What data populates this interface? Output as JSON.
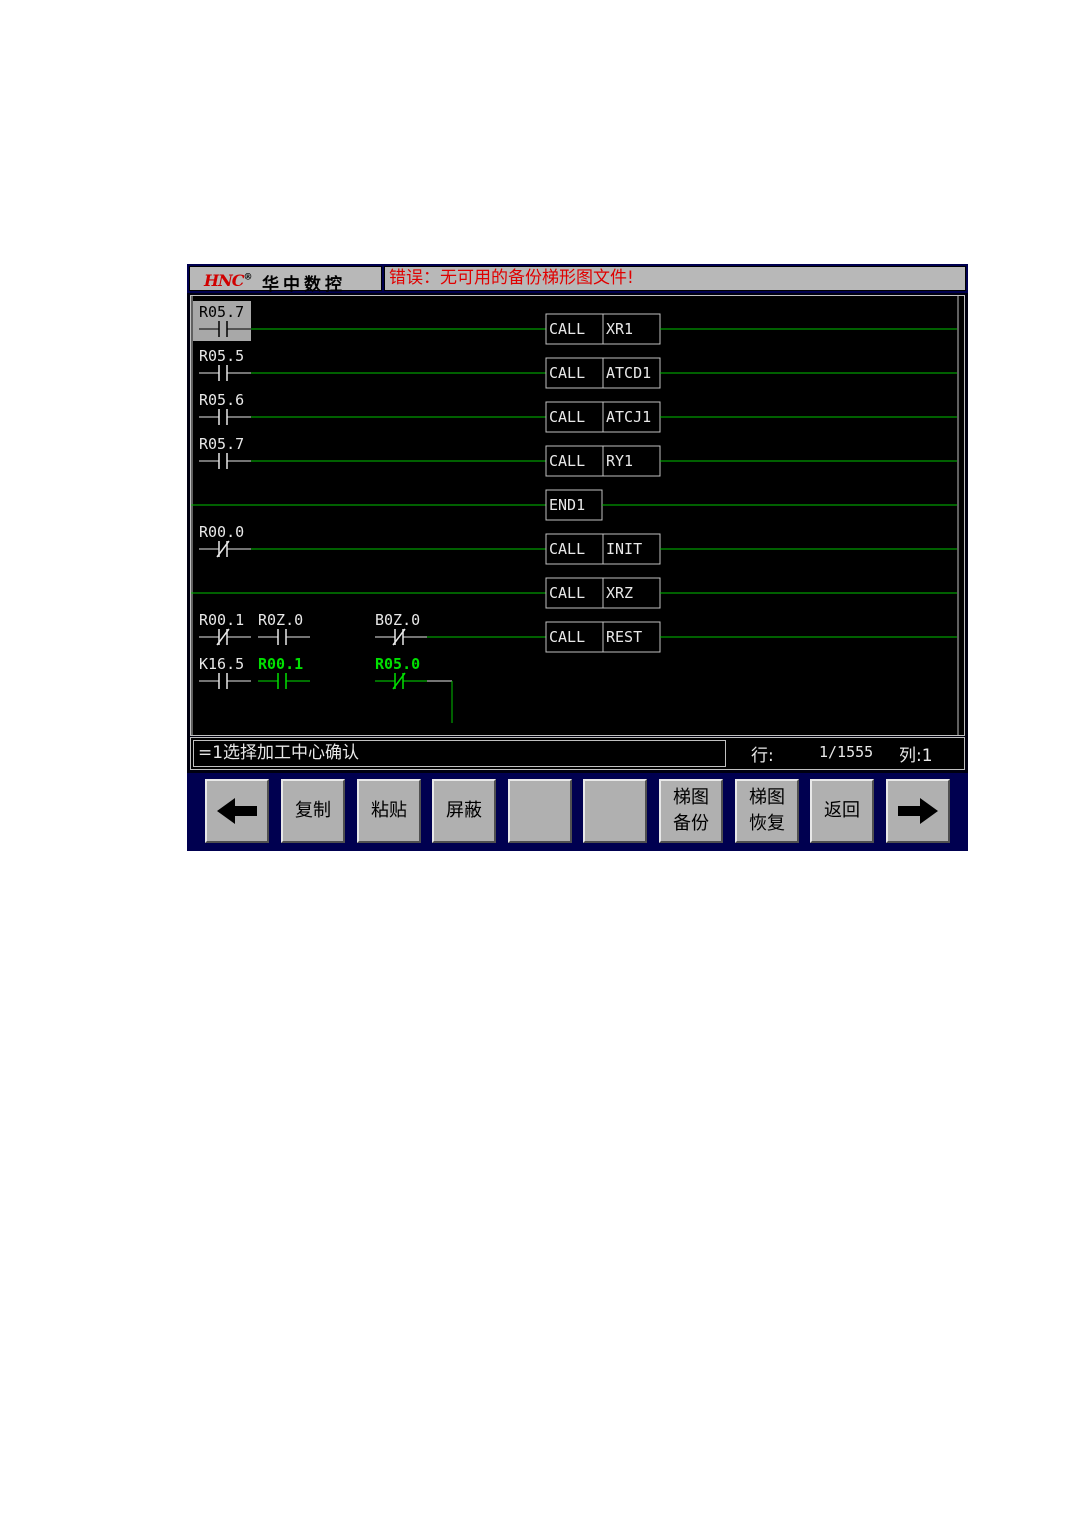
{
  "header": {
    "logo_mark": "HNC",
    "logo_text": "华中数控",
    "error_message": "错误：无可用的备份梯形图文件!"
  },
  "ladder": {
    "rungs": [
      {
        "contacts": [
          {
            "label": "R05.7",
            "type": "NO",
            "selected": true
          }
        ],
        "coil": {
          "op": "CALL",
          "arg": "XR1"
        }
      },
      {
        "contacts": [
          {
            "label": "R05.5",
            "type": "NO"
          }
        ],
        "coil": {
          "op": "CALL",
          "arg": "ATCD1"
        }
      },
      {
        "contacts": [
          {
            "label": "R05.6",
            "type": "NO"
          }
        ],
        "coil": {
          "op": "CALL",
          "arg": "ATCJ1"
        }
      },
      {
        "contacts": [
          {
            "label": "R05.7",
            "type": "NO"
          }
        ],
        "coil": {
          "op": "CALL",
          "arg": "RY1"
        }
      },
      {
        "contacts": [],
        "coil": {
          "op": "END1",
          "arg": ""
        }
      },
      {
        "contacts": [
          {
            "label": "R00.0",
            "type": "NC"
          }
        ],
        "coil": {
          "op": "CALL",
          "arg": "INIT"
        }
      },
      {
        "contacts": [],
        "coil": {
          "op": "CALL",
          "arg": "XRZ"
        }
      },
      {
        "contacts": [
          {
            "label": "R00.1",
            "type": "NC"
          },
          {
            "label": "R0Z.0",
            "type": "NO"
          },
          {
            "label": "B0Z.0",
            "type": "NC"
          }
        ],
        "coil": {
          "op": "CALL",
          "arg": "REST"
        }
      },
      {
        "contacts": [
          {
            "label": "K16.5",
            "type": "NO"
          },
          {
            "label": "R00.1",
            "type": "NO",
            "active": true
          },
          {
            "label": "R05.0",
            "type": "NC",
            "active": true
          }
        ],
        "coil": null
      }
    ]
  },
  "status": {
    "message": "=1选择加工中心确认",
    "row_label": "行:",
    "row_value": "1/1555",
    "col_label": "列:1"
  },
  "fkeys": [
    {
      "id": "left",
      "label": "",
      "icon": "arrow-left-icon"
    },
    {
      "id": "copy",
      "label": "复制"
    },
    {
      "id": "paste",
      "label": "粘贴"
    },
    {
      "id": "mask",
      "label": "屏蔽"
    },
    {
      "id": "blank1",
      "label": ""
    },
    {
      "id": "blank2",
      "label": ""
    },
    {
      "id": "backup",
      "label": "梯图\n备份"
    },
    {
      "id": "restore",
      "label": "梯图\n恢复"
    },
    {
      "id": "return",
      "label": "返回"
    },
    {
      "id": "right",
      "label": "",
      "icon": "arrow-right-icon"
    }
  ],
  "colors": {
    "frame": "#000050",
    "rung_line": "#00c000",
    "text": "#e8e8e8",
    "active": "#00e000",
    "error": "#e00000",
    "button": "#b0b0b0"
  }
}
